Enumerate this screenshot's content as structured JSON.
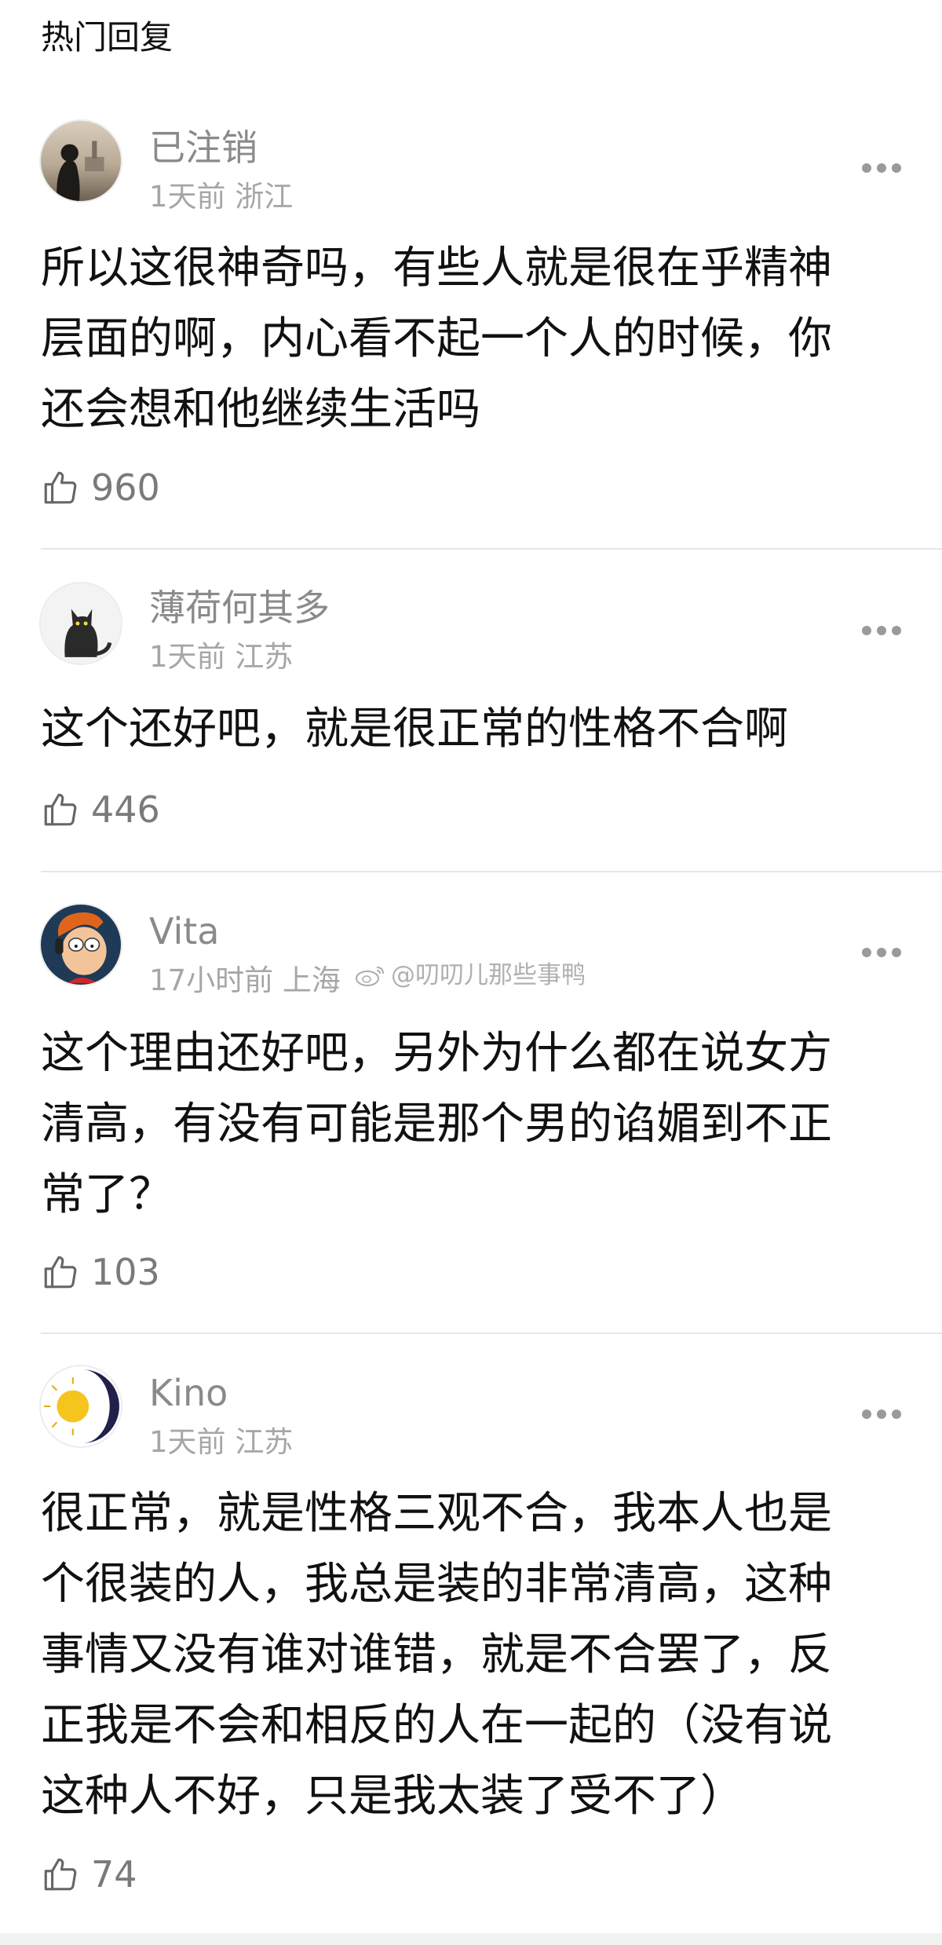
{
  "header": {
    "title": "热门回复"
  },
  "comments": [
    {
      "username": "已注销",
      "time": "1天前",
      "location": "浙江",
      "text": "所以这很神奇吗，有些人就是很在乎精神\n层面的啊，内心看不起一个人的时候，你\n还会想和他继续生活吗",
      "likes": "960"
    },
    {
      "username": "薄荷何其多",
      "time": "1天前",
      "location": "江苏",
      "text": "这个还好吧，就是很正常的性格不合啊",
      "likes": "446"
    },
    {
      "username": "Vita",
      "time": "17小时前",
      "location": "上海",
      "text": "这个理由还好吧，另外为什么都在说女方\n清高，有没有可能是那个男的谄媚到不正\n常了？",
      "likes": "103"
    },
    {
      "username": "Kino",
      "time": "1天前",
      "location": "江苏",
      "text": "很正常，就是性格三观不合，我本人也是\n个很装的人，我总是装的非常清高，这种\n事情又没有谁对谁错，就是不合罢了，反\n正我是不会和相反的人在一起的（没有说\n这种人不好，只是我太装了受不了）",
      "likes": "74"
    }
  ],
  "watermark": {
    "text": "@叨叨儿那些事鸭"
  },
  "icons": {
    "like": "thumbs-up-icon",
    "more": "more-dots-icon"
  }
}
